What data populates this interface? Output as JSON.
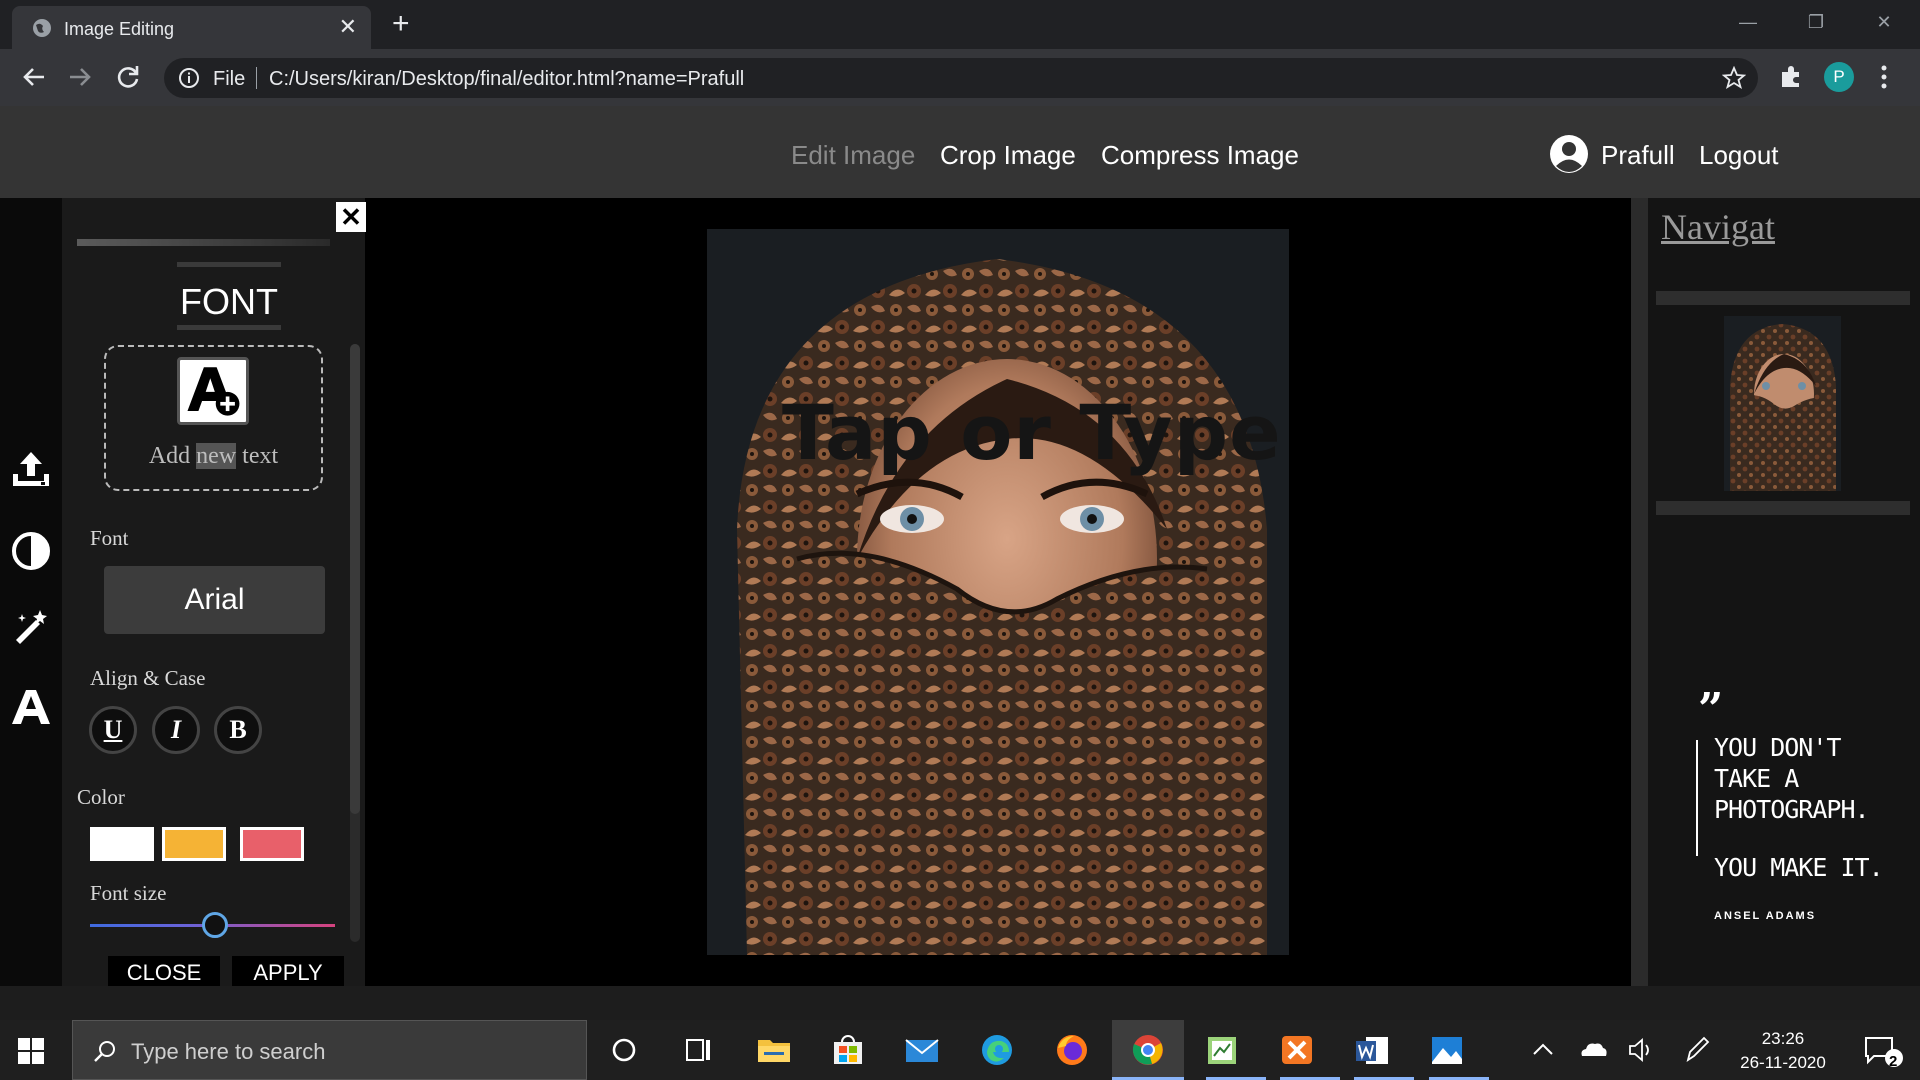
{
  "browser": {
    "tab_title": "Image Editing",
    "tab_close": "✕",
    "new_tab": "+",
    "omnibox_scheme": "File",
    "url": "C:/Users/kiran/Desktop/final/editor.html?name=Prafull",
    "profile_initial": "P"
  },
  "header": {
    "nav": [
      "Edit Image",
      "Crop Image",
      "Compress Image"
    ],
    "active_nav": "Edit Image",
    "user_name": "Prafull",
    "logout": "Logout"
  },
  "left_rail": {
    "icons": [
      "upload-icon",
      "contrast-icon",
      "magic-wand-icon",
      "text-icon"
    ]
  },
  "font_panel": {
    "close_label": "✕",
    "title": "FONT",
    "add_text": {
      "before": "Add ",
      "highlight": "new",
      "after": " text"
    },
    "font_label": "Font",
    "font_value": "Arial",
    "align_label": "Align & Case",
    "style_buttons": [
      "U",
      "I",
      "B"
    ],
    "color_label": "Color",
    "colors": [
      "#ffffff",
      "#f5b335",
      "#e8606a"
    ],
    "size_label": "Font size",
    "size_value_fraction": 0.43,
    "close_button": "CLOSE",
    "apply_button": "APPLY"
  },
  "canvas": {
    "overlay_text": "Tap or Type"
  },
  "right_panel": {
    "title": "Navigat",
    "quote_mark": "”",
    "quote_lines": [
      "YOU DON'T",
      "TAKE A",
      "PHOTOGRAPH."
    ],
    "quote_line2": "YOU MAKE IT.",
    "quote_author": "ANSEL ADAMS"
  },
  "taskbar": {
    "search_placeholder": "Type here to search",
    "time": "23:26",
    "date": "26-11-2020",
    "notification_count": "2"
  },
  "colors": {
    "header_bg": "#343434",
    "panel_bg": "#1a1a1a",
    "accent_blue": "#5fa6e6"
  }
}
